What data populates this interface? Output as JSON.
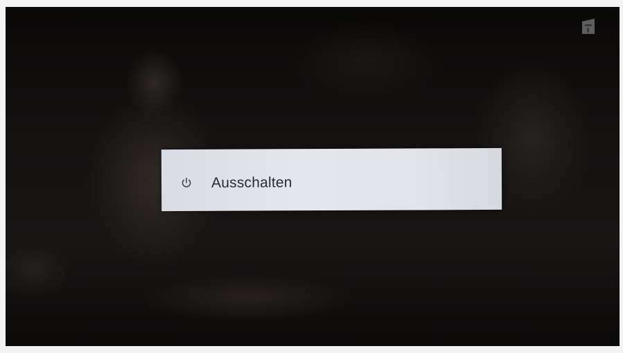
{
  "menu": {
    "items": [
      {
        "label": "Ausschalten",
        "icon": "power-icon"
      }
    ]
  },
  "colors": {
    "panel_background": "#e1e4ea",
    "panel_text": "#2a2c30",
    "screen_background": "#141211",
    "logo": "#6a6a6a"
  },
  "channel_logo": {
    "icon": "channel-logo"
  }
}
